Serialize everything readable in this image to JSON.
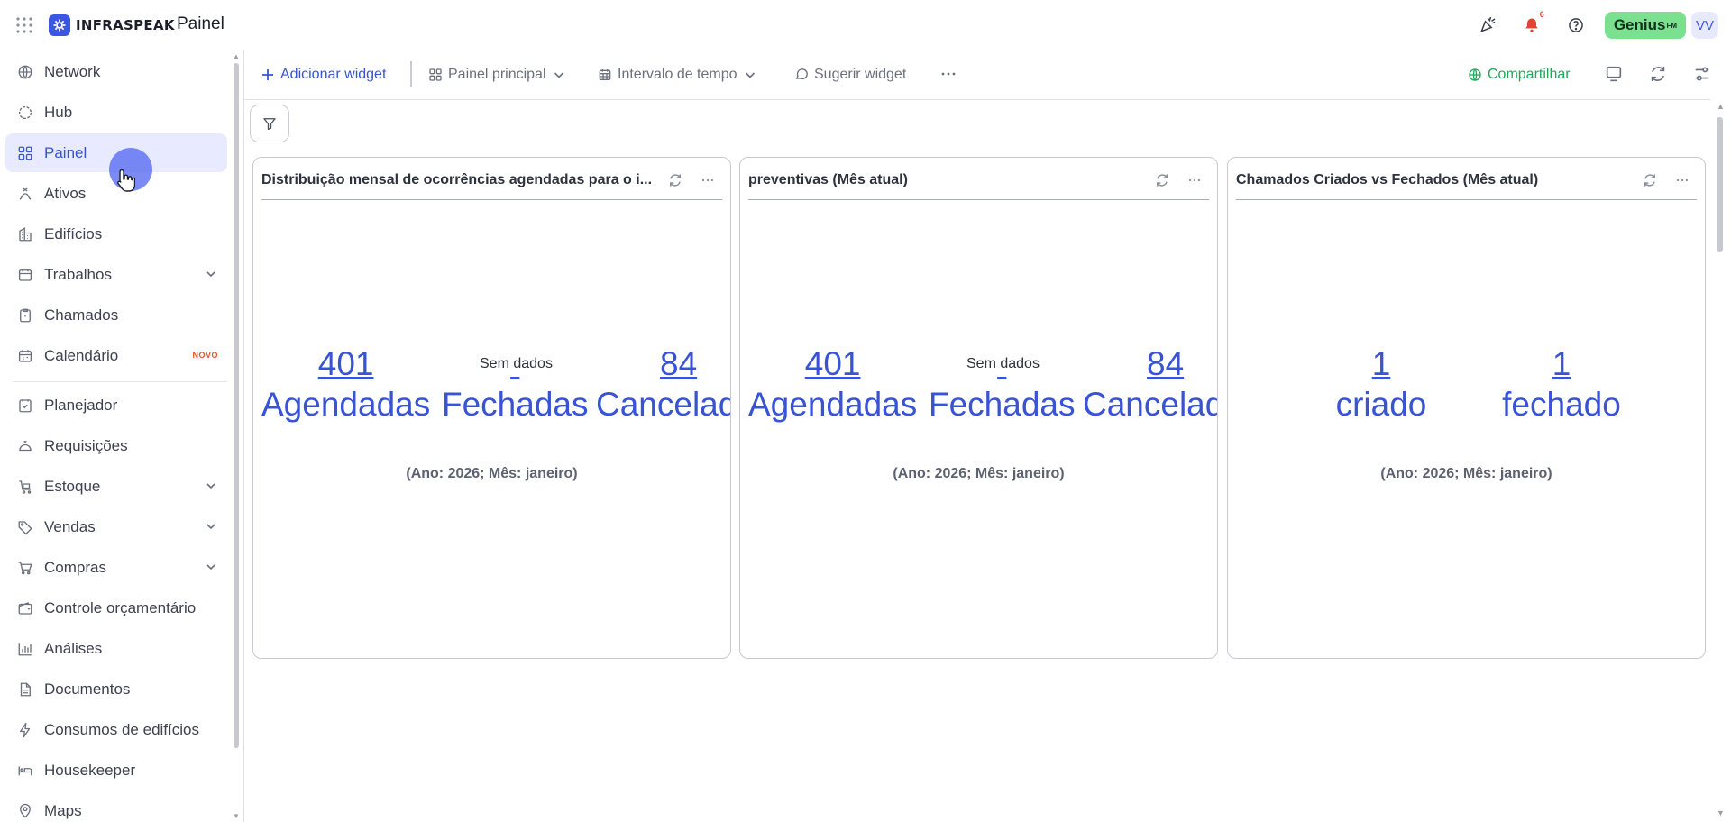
{
  "header": {
    "brand": "INFRASPEAK",
    "page_title": "Painel",
    "notifications_count": "6",
    "genius_label": "Genius",
    "genius_sup": "FM",
    "avatar_initials": "VV"
  },
  "sidebar": {
    "items": [
      {
        "label": "Network",
        "icon": "globe-icon"
      },
      {
        "label": "Hub",
        "icon": "hub-icon"
      },
      {
        "label": "Painel",
        "icon": "dashboard-icon",
        "active": true
      },
      {
        "label": "Ativos",
        "icon": "assets-icon"
      },
      {
        "label": "Edifícios",
        "icon": "building-icon"
      },
      {
        "label": "Trabalhos",
        "icon": "calendar-icon",
        "expandable": true
      },
      {
        "label": "Chamados",
        "icon": "clipboard-icon"
      },
      {
        "label": "Calendário",
        "icon": "calendar-icon",
        "badge": "NOVO"
      },
      {
        "label": "Planejador",
        "icon": "planner-icon"
      },
      {
        "label": "Requisições",
        "icon": "bell-service-icon"
      },
      {
        "label": "Estoque",
        "icon": "stock-icon",
        "expandable": true
      },
      {
        "label": "Vendas",
        "icon": "tag-icon",
        "expandable": true
      },
      {
        "label": "Compras",
        "icon": "cart-icon",
        "expandable": true
      },
      {
        "label": "Controle orçamentário",
        "icon": "wallet-icon"
      },
      {
        "label": "Análises",
        "icon": "bar-chart-icon"
      },
      {
        "label": "Documentos",
        "icon": "document-icon"
      },
      {
        "label": "Consumos de edifícios",
        "icon": "lightning-icon"
      },
      {
        "label": "Housekeeper",
        "icon": "bed-icon"
      },
      {
        "label": "Maps",
        "icon": "map-pin-icon"
      }
    ]
  },
  "toolbar": {
    "add_widget": "Adicionar widget",
    "main_panel": "Painel principal",
    "time_interval": "Intervalo de tempo",
    "suggest_widget": "Sugerir widget",
    "share": "Compartilhar"
  },
  "widgets": [
    {
      "title": "Distribuição mensal de ocorrências agendadas para o i...",
      "kpis": [
        {
          "value": "401",
          "label": "Agendadas"
        },
        {
          "value": "",
          "label": "Fechadas"
        },
        {
          "value": "84",
          "label": "Cancelad"
        }
      ],
      "no_data": "Sem dados",
      "period": "(Ano: 2026; Mês: janeiro)"
    },
    {
      "title": "preventivas (Mês atual)",
      "kpis": [
        {
          "value": "401",
          "label": "Agendadas"
        },
        {
          "value": "",
          "label": "Fechadas"
        },
        {
          "value": "84",
          "label": "Cancelad"
        }
      ],
      "no_data": "Sem dados",
      "period": "(Ano: 2026; Mês: janeiro)"
    },
    {
      "title": "Chamados Criados vs Fechados (Mês atual)",
      "kpis": [
        {
          "value": "1",
          "label": "criado"
        },
        {
          "value": "1",
          "label": "fechado"
        }
      ],
      "period": "(Ano: 2026; Mês: janeiro)"
    }
  ],
  "colors": {
    "accent": "#3853d6",
    "share": "#20a85a",
    "genius_bg": "#7be08f",
    "notification": "#e5432f"
  }
}
